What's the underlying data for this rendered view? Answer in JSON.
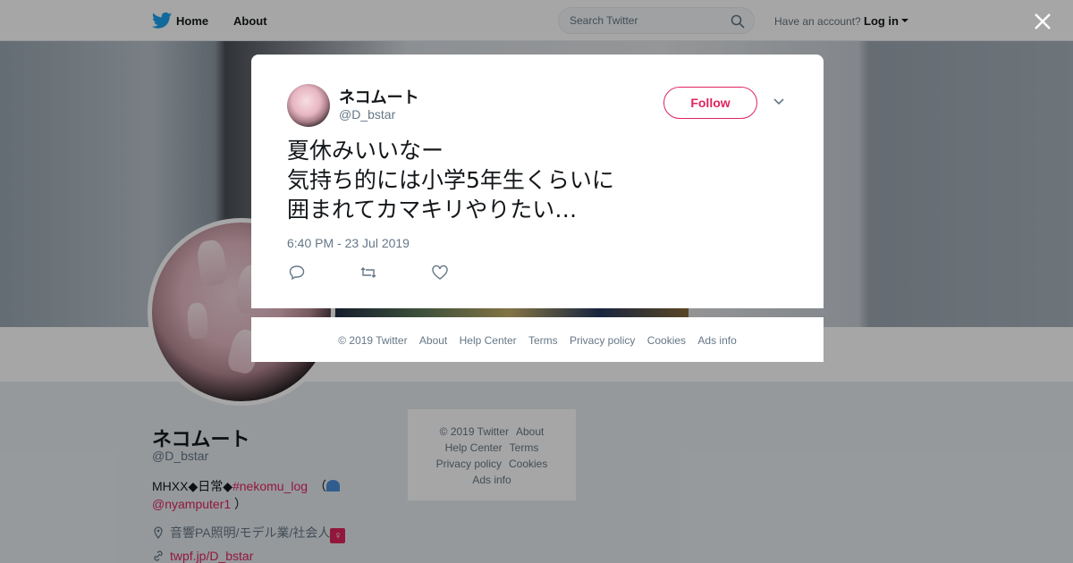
{
  "nav": {
    "home": "Home",
    "about": "About",
    "search_placeholder": "Search Twitter",
    "have_account": "Have an account?",
    "login": "Log in"
  },
  "profile": {
    "name": "ネコムート",
    "handle": "@D_bstar",
    "bio_prefix": "MHXX◆日常◆",
    "bio_hashtag": "#nekomu_log",
    "bio_paren_open": "（",
    "bio_mention": "@nyamputer1",
    "bio_paren_close": "）",
    "location": "音響PA照明/モデル業/社会人",
    "link": "twpf.jp/D_bstar"
  },
  "side_footer": {
    "items": [
      "© 2019 Twitter",
      "About",
      "Help Center",
      "Terms",
      "Privacy policy",
      "Cookies",
      "Ads info"
    ]
  },
  "tweet": {
    "author_name": "ネコムート",
    "author_handle": "@D_bstar",
    "follow_label": "Follow",
    "text": "夏休みいいなー\n気持ち的には小学5年生くらいに\n囲まれてカマキリやりたい…",
    "timestamp": "6:40 PM - 23 Jul 2019"
  },
  "modal_footer": {
    "items": [
      "© 2019 Twitter",
      "About",
      "Help Center",
      "Terms",
      "Privacy policy",
      "Cookies",
      "Ads info"
    ]
  },
  "colors": {
    "accent": "#e0245e",
    "twitter_blue": "#1da1f2",
    "muted_text": "#657786"
  },
  "icons": [
    "twitter-bird-icon",
    "search-icon",
    "caret-down-icon",
    "close-icon",
    "chevron-down-icon",
    "reply-icon",
    "retweet-icon",
    "like-icon",
    "location-icon",
    "link-icon"
  ]
}
